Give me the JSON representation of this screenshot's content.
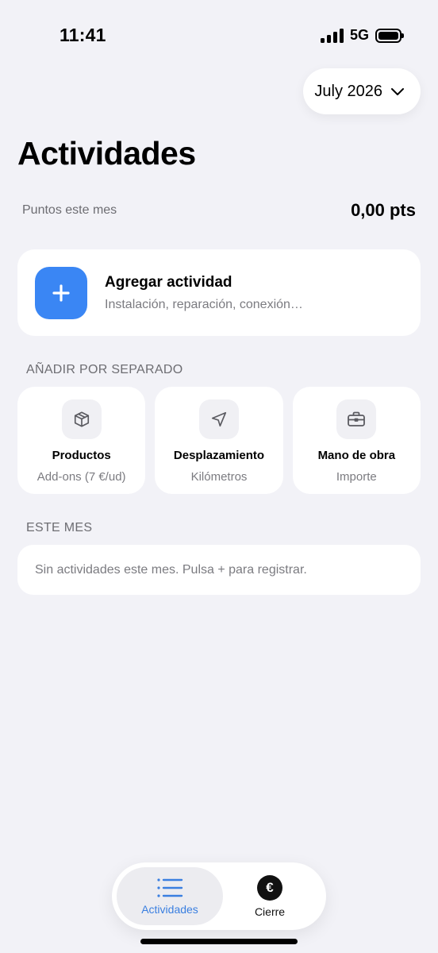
{
  "status_bar": {
    "time": "11:41",
    "network": "5G"
  },
  "header": {
    "month": "July 2026",
    "title": "Actividades"
  },
  "points": {
    "label": "Puntos este mes",
    "value": "0,00 pts"
  },
  "add_activity": {
    "title": "Agregar actividad",
    "subtitle": "Instalación, reparación, conexión…"
  },
  "separate_section": {
    "header": "AÑADIR POR SEPARADO",
    "tiles": [
      {
        "title": "Productos",
        "subtitle": "Add-ons (7 €/ud)",
        "icon": "box-icon"
      },
      {
        "title": "Desplazamiento",
        "subtitle": "Kilómetros",
        "icon": "location-arrow-icon"
      },
      {
        "title": "Mano de obra",
        "subtitle": "Importe",
        "icon": "briefcase-icon"
      }
    ]
  },
  "month_section": {
    "header": "ESTE MES",
    "empty_text": "Sin actividades este mes. Pulsa + para registrar."
  },
  "tab_bar": {
    "tabs": [
      {
        "label": "Actividades",
        "icon": "list-icon",
        "active": true
      },
      {
        "label": "Cierre",
        "icon": "euro-icon",
        "active": false
      }
    ],
    "euro_symbol": "€"
  },
  "colors": {
    "accent": "#3a86f4",
    "background": "#f2f2f7",
    "card": "#ffffff",
    "secondary_text": "#7b7b80"
  }
}
